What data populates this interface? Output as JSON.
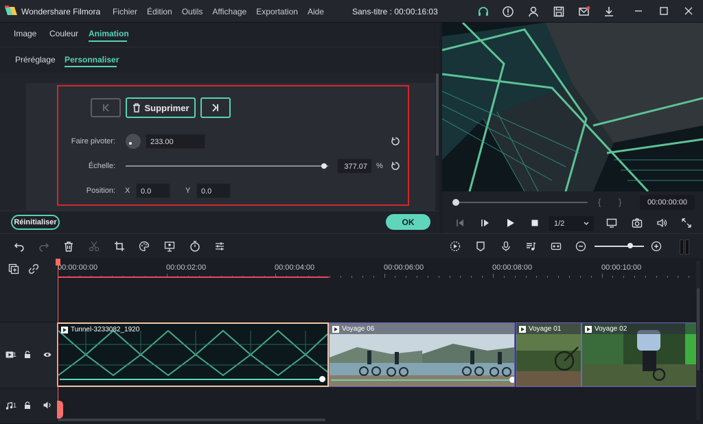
{
  "titlebar": {
    "app_name": "Wondershare Filmora",
    "menu": [
      "Fichier",
      "Édition",
      "Outils",
      "Affichage",
      "Exportation",
      "Aide"
    ],
    "doc_title": "Sans-titre : 00:00:16:03",
    "icons": [
      "headset-icon",
      "info-icon",
      "account-icon",
      "save-icon",
      "mail-icon",
      "download-icon",
      "minimize-icon",
      "maximize-icon",
      "close-icon"
    ],
    "colors": {
      "accent": "#58d1b8",
      "notification": "#e8453c"
    }
  },
  "edit_panel": {
    "tabs": [
      "Image",
      "Couleur",
      "Animation"
    ],
    "active_tab": "Animation",
    "subtabs": [
      "Préréglage",
      "Personnaliser"
    ],
    "active_subtab": "Personnaliser",
    "keyframe": {
      "prev_label": "",
      "delete_label": "Supprimer",
      "next_label": ""
    },
    "rotate": {
      "label": "Faire pivoter:",
      "value": "233.00"
    },
    "scale": {
      "label": "Échelle:",
      "value": "377.07",
      "unit": "%",
      "level": 0.98
    },
    "position": {
      "label": "Position:",
      "x_label": "X",
      "x_value": "0.0",
      "y_label": "Y",
      "y_value": "0.0"
    },
    "reset_label": "Réinitialiser",
    "ok_label": "OK"
  },
  "player": {
    "progress": 0.0,
    "brace_open": "{",
    "brace_close": "}",
    "timecode": "00:00:00:00",
    "ratio": "1/2"
  },
  "timeline": {
    "ruler_labels": [
      "00:00:00:00",
      "00:00:02:00",
      "00:00:04:00",
      "00:00:06:00",
      "00:00:08:00",
      "00:00:10:00"
    ],
    "video_track": {
      "number": "1"
    },
    "audio_track": {
      "number": "1"
    },
    "clips": [
      {
        "title": "Tunnel-3233082_1920"
      },
      {
        "title": "Voyage 06"
      },
      {
        "title": "Voyage 01"
      },
      {
        "title": "Voyage 02"
      }
    ]
  }
}
